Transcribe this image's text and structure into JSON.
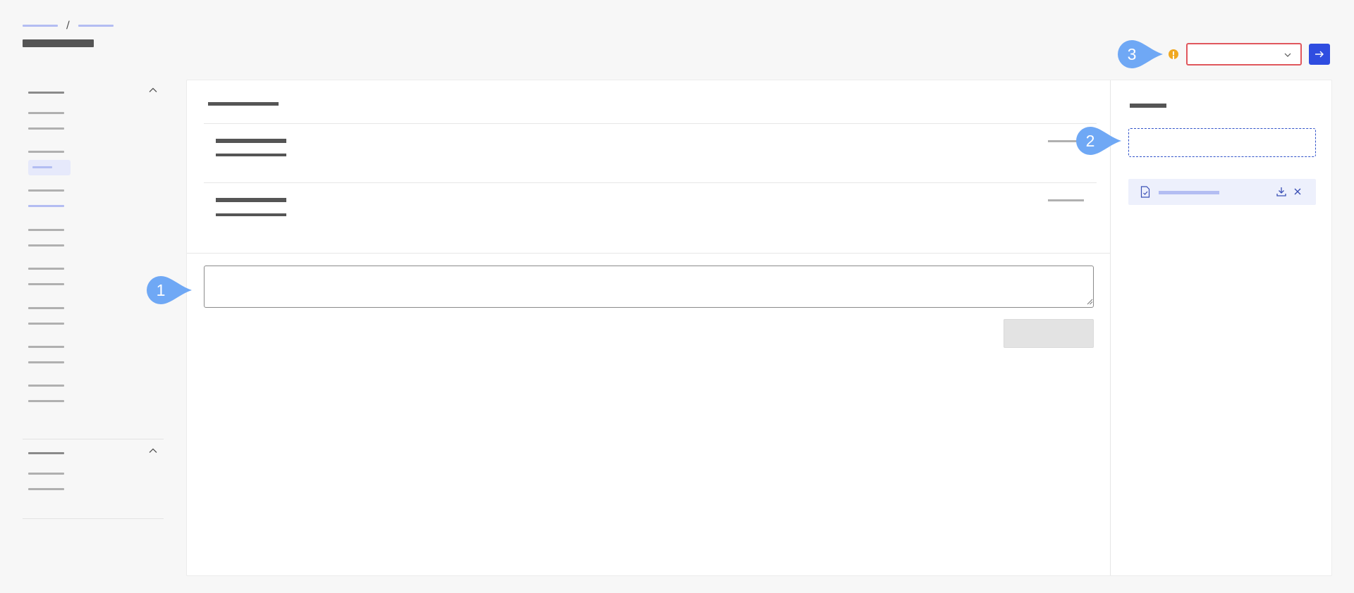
{
  "breadcrumb": {
    "separator": "/"
  },
  "callouts": [
    {
      "number": "1"
    },
    {
      "number": "2"
    },
    {
      "number": "3"
    }
  ],
  "colors": {
    "accent": "#2f4de0",
    "warning": "#f0a820",
    "error_border": "#e0575d",
    "callout": "#6fa8f5",
    "link_placeholder": "#b3bdf2"
  },
  "icons": {
    "chevron_up": "chevron-up-icon",
    "chevron_down": "chevron-down-icon",
    "arrow_right": "arrow-right-icon",
    "warning": "warning-icon",
    "file": "file-check-icon",
    "download": "download-icon",
    "close": "close-icon"
  }
}
